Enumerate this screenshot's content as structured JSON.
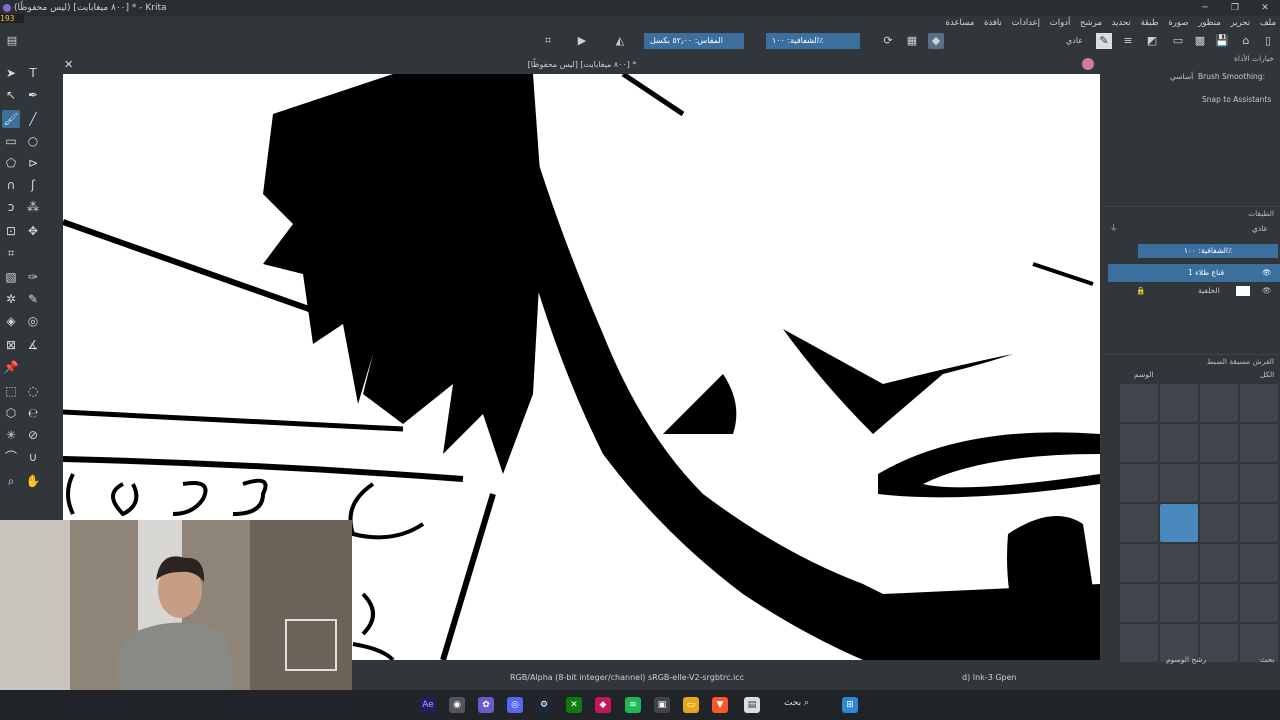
{
  "window": {
    "title": "(ليس محفوظًا) [٨٠٠ ميغابايت] * - Krita",
    "fps": "193",
    "controls": [
      "─",
      "❐",
      "✕"
    ]
  },
  "menubar": {
    "items": [
      "ملف",
      "تحرير",
      "منظور",
      "صورة",
      "طبقة",
      "تحديد",
      "مرشح",
      "أدوات",
      "إعدادات",
      "نافذة",
      "مساعدة"
    ]
  },
  "toolbar": {
    "blend_mode": "عادي",
    "opacity": "الشفافية: ١٠٠٪",
    "size": "المقاس: ٥٢٫٠٠ بكسل"
  },
  "document": {
    "tab_title": "[ليس محفوظًا] [٨٠٠ ميغابايت] *"
  },
  "tool_options": {
    "title": "خيارات الأداة",
    "brush_smoothing_label": "Brush Smoothing:",
    "brush_smoothing_value": "أساسي",
    "snap_label": "Snap to Assistants"
  },
  "layers": {
    "title": "الطبقات",
    "blend_mode": "عادي",
    "opacity": "الشفافية: ١٠٠٪",
    "items": [
      {
        "name": "قناع طلاء 1",
        "selected": true
      },
      {
        "name": "الخلفية",
        "selected": false
      }
    ]
  },
  "brushes": {
    "title": "الفرش مسبقة الضبط",
    "tag_label": "الوسم",
    "filter_all": "الكل",
    "filter_tag": "رشح الوسوم",
    "search_label": "بحث"
  },
  "status": {
    "color_info": "RGB/Alpha (8-bit integer/channel)  sRGB-elle-V2-srgbtrc.icc",
    "brush_name": "d) Ink-3 Gpen"
  },
  "taskbar": {
    "search_label": "بحث",
    "apps": [
      "Ae",
      "Chrome",
      "Krita",
      "Discord",
      "Steam",
      "Xbox",
      "App",
      "Spotify",
      "Store",
      "Files",
      "Brave",
      "Notes"
    ]
  },
  "colors": {
    "accent": "#4a89bf",
    "panel": "#31363b",
    "selected_layer": "#3b6f9e"
  }
}
